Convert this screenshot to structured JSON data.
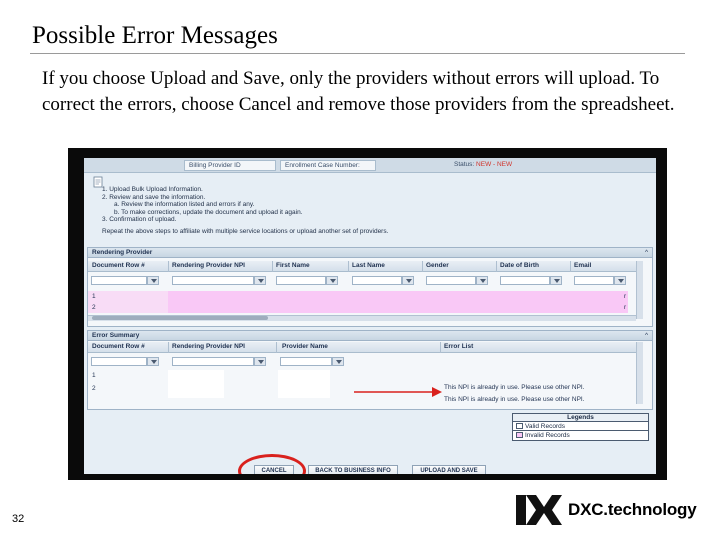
{
  "slide": {
    "title": "Possible Error Messages",
    "body": "If you choose Upload and Save, only the providers without errors will upload. To correct the errors, choose Cancel and remove those providers from the spreadsheet.",
    "page_number": "32",
    "logo_text": "DXC.technology"
  },
  "app": {
    "header": {
      "billing_provider_label": "Billing Provider ID",
      "enrollment_case_label": "Enrollment Case Number:",
      "status_label": "Status:",
      "status_value": "NEW - NEW"
    },
    "instructions": [
      "1.   Upload Bulk Upload Information.",
      "2.   Review and save the information.",
      "a.   Review the information listed and errors if any.",
      "b.   To make corrections, update the document and upload it again.",
      "3.   Confirmation of upload.",
      "Repeat the above steps to affiliate with multiple service locations or upload another set of providers."
    ],
    "rendering_provider": {
      "title": "Rendering Provider",
      "columns": [
        "Document Row #",
        "Rendering Provider NPI",
        "First Name",
        "Last Name",
        "Gender",
        "Date of Birth",
        "Email"
      ],
      "rows": [
        "1",
        "2"
      ],
      "row_tail": [
        "r",
        "r"
      ]
    },
    "error_summary": {
      "title": "Error Summary",
      "columns": [
        "Document Row #",
        "Rendering Provider NPI",
        "Provider Name",
        "Error List"
      ],
      "rows": [
        {
          "row": "1",
          "error": "This NPI is already in use. Please use other NPI."
        },
        {
          "row": "2",
          "error": "This NPI is already in use. Please use other NPI."
        }
      ]
    },
    "legend": {
      "title": "Legends",
      "items": [
        "Valid Records",
        "Invalid Records"
      ]
    },
    "buttons": {
      "cancel": "CANCEL",
      "back": "BACK TO BUSINESS INFO",
      "upload_save": "UPLOAD AND SAVE"
    },
    "panel_caret": "^",
    "colors": {
      "invalid_highlight": "#f9c8f6",
      "annotation_red": "#d9211d",
      "status_red": "#d0342c"
    }
  }
}
